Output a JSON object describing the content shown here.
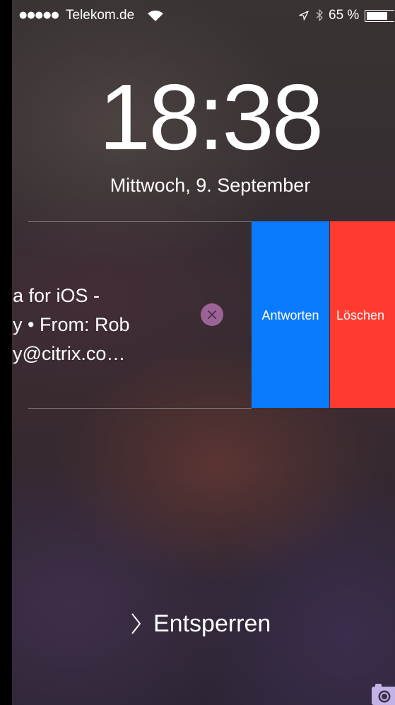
{
  "status_bar": {
    "signal_dots": "●●●●●",
    "carrier": "Telekom.de",
    "battery_percent": "65 %",
    "battery_level": 0.65
  },
  "lock_screen": {
    "time": "18:38",
    "date": "Mittwoch, 9. September",
    "unlock_label": "Entsperren"
  },
  "notification": {
    "lines": [
      "a for iOS -",
      "y • From: Rob",
      "y@citrix.co…"
    ],
    "actions": [
      {
        "label": "Antworten",
        "color": "#0b7bfd"
      },
      {
        "label": "Löschen",
        "color": "#ff3b30"
      }
    ]
  },
  "icons": {
    "wifi": "wifi-icon",
    "location": "location-arrow-icon",
    "bluetooth": "bluetooth-icon",
    "battery": "battery-icon",
    "close": "close-icon",
    "unlock": "chevron-right-icon",
    "camera": "camera-icon"
  },
  "colors": {
    "reply": "#0b7bfd",
    "delete": "#ff3b30",
    "close_button": "#9c6396",
    "camera": "#c3b2e6"
  }
}
